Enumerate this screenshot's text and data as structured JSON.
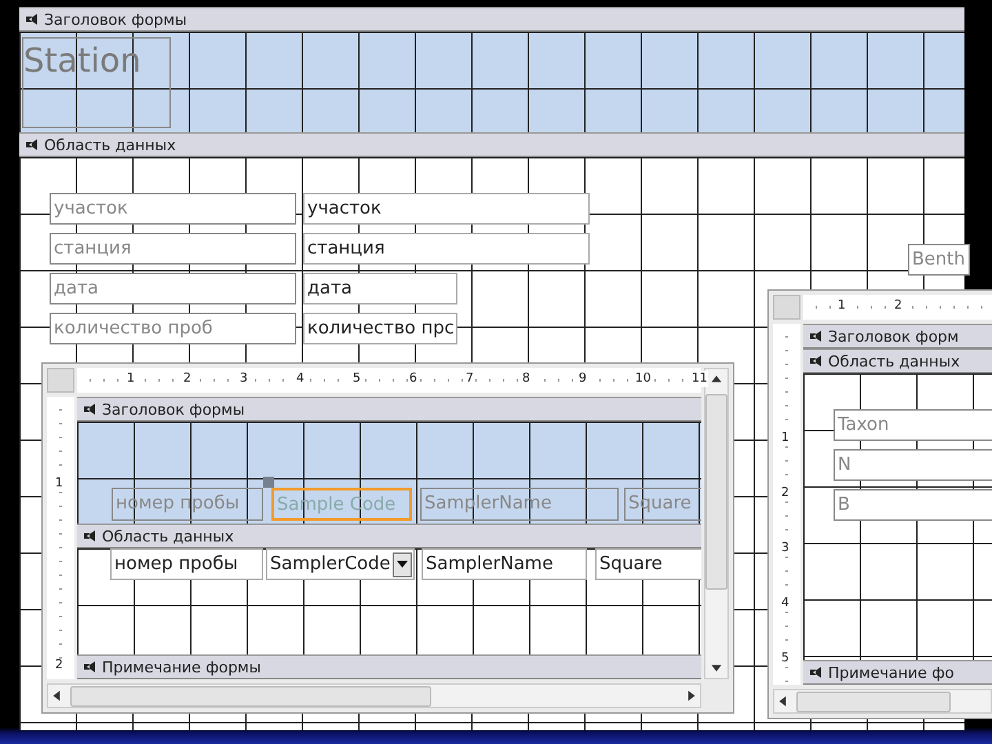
{
  "main_form": {
    "header_section": "Заголовок формы",
    "title_label": "Station",
    "detail_section": "Область данных",
    "fields": [
      {
        "label": "участок",
        "value": "участок",
        "wide": true
      },
      {
        "label": "станция",
        "value": "станция",
        "wide": true
      },
      {
        "label": "дата",
        "value": "дата",
        "wide": false
      },
      {
        "label": "количество проб",
        "value": "количество прс",
        "wide": false
      }
    ],
    "side_label": "Benth"
  },
  "subform_samples": {
    "ruler_h": [
      "1",
      "2",
      "3",
      "4",
      "5",
      "6",
      "7",
      "8",
      "9",
      "10",
      "11"
    ],
    "ruler_v": [
      "1",
      "2"
    ],
    "header_section": "Заголовок формы",
    "header_labels": [
      {
        "text": "номер пробы",
        "selected": false
      },
      {
        "text": "Sample Code",
        "selected": true
      },
      {
        "text": "SamplerName",
        "selected": false
      },
      {
        "text": "Square",
        "selected": false
      }
    ],
    "detail_section": "Область данных",
    "detail_controls": [
      {
        "kind": "textbox",
        "text": "номер пробы"
      },
      {
        "kind": "combo",
        "text": "SamplerCode"
      },
      {
        "kind": "textbox",
        "text": "SamplerName"
      },
      {
        "kind": "textbox",
        "text": "Square"
      }
    ],
    "footer_section": "Примечание формы"
  },
  "subform_taxa": {
    "ruler_h": [
      "1",
      "2"
    ],
    "ruler_v": [
      "1",
      "2",
      "3",
      "4",
      "5"
    ],
    "header_section": "Заголовок форм",
    "detail_section": "Область данных",
    "detail_labels": [
      "Taxon",
      "N",
      "B"
    ],
    "footer_section": "Примечание фо"
  }
}
